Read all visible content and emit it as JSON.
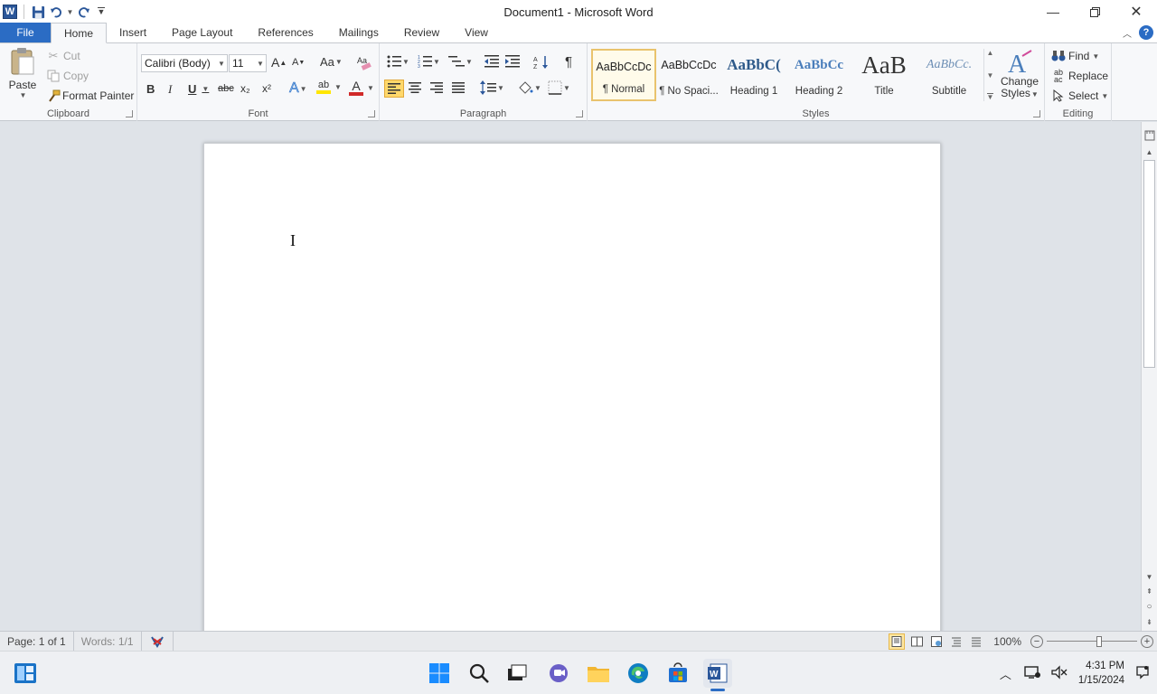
{
  "window": {
    "title": "Document1  -  Microsoft Word",
    "app_icon": "W"
  },
  "tabs": [
    {
      "label": "File"
    },
    {
      "label": "Home"
    },
    {
      "label": "Insert"
    },
    {
      "label": "Page Layout"
    },
    {
      "label": "References"
    },
    {
      "label": "Mailings"
    },
    {
      "label": "Review"
    },
    {
      "label": "View"
    }
  ],
  "clipboard": {
    "group_label": "Clipboard",
    "paste": "Paste",
    "cut": "Cut",
    "copy": "Copy",
    "format_painter": "Format Painter"
  },
  "font": {
    "group_label": "Font",
    "font_name": "Calibri (Body)",
    "font_size": "11",
    "change_case": "Aa",
    "bold": "B",
    "italic": "I",
    "underline": "U",
    "strikethrough": "abc",
    "subscript": "x₂",
    "superscript": "x²",
    "grow_font": "A",
    "shrink_font": "A",
    "text_effects": "A",
    "font_color": "A",
    "highlight": "ab"
  },
  "paragraph": {
    "group_label": "Paragraph",
    "show_marks": "¶"
  },
  "styles": {
    "group_label": "Styles",
    "items": [
      {
        "preview": "AaBbCcDc",
        "name": "¶ Normal"
      },
      {
        "preview": "AaBbCcDc",
        "name": "¶ No Spaci..."
      },
      {
        "preview": "AaBbC(",
        "name": "Heading 1"
      },
      {
        "preview": "AaBbCc",
        "name": "Heading 2"
      },
      {
        "preview": "AaB",
        "name": "Title"
      },
      {
        "preview": "AaBbCc.",
        "name": "Subtitle"
      }
    ],
    "change_styles_line1": "Change",
    "change_styles_line2": "Styles"
  },
  "editing": {
    "group_label": "Editing",
    "find": "Find",
    "replace": "Replace",
    "select": "Select"
  },
  "document": {
    "cursor_glyph": "I"
  },
  "status": {
    "page": "Page: 1 of 1",
    "words": "Words: 1/1",
    "zoom": "100%",
    "zoom_fraction": 0.58
  },
  "taskbar": {
    "time": "4:31 PM",
    "date": "1/15/2024"
  },
  "colors": {
    "accent": "#2b6cc4",
    "word_blue": "#2b579a",
    "highlight_yellow": "#ffe600",
    "font_red": "#d12a2a"
  }
}
